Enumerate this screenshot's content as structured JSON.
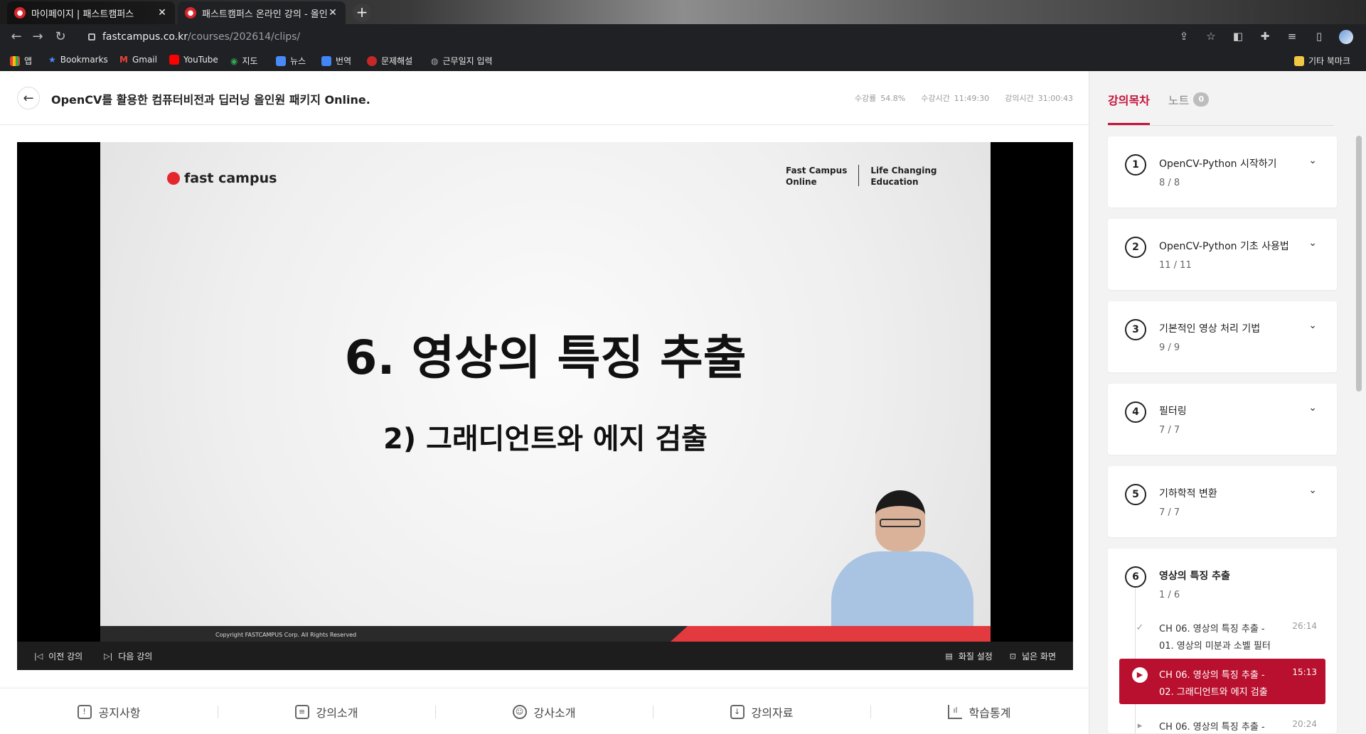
{
  "browser": {
    "tabs": [
      {
        "title": "마이페이지 | 패스트캠퍼스",
        "close": "✕"
      },
      {
        "title": "패스트캠퍼스 온라인 강의 - 올인",
        "close": "✕"
      }
    ],
    "new_tab": "+",
    "url_host": "fastcampus.co.kr",
    "url_path": "/courses/202614/clips/",
    "bookmarks": [
      "앱",
      "Bookmarks",
      "Gmail",
      "YouTube",
      "지도",
      "뉴스",
      "번역",
      "문제해설",
      "근무일지 입력"
    ],
    "other_bookmarks": "기타 북마크"
  },
  "header": {
    "course_title": "OpenCV를 활용한 컴퓨터비전과 딥러닝 올인원 패키지 Online.",
    "stats": [
      {
        "label": "수강률",
        "value": "54.8%"
      },
      {
        "label": "수강시간",
        "value": "11:49:30"
      },
      {
        "label": "강의시간",
        "value": "31:00:43"
      }
    ]
  },
  "slide": {
    "logo": "fast campus",
    "brand_left_1": "Fast Campus",
    "brand_left_2": "Online",
    "brand_right_1": "Life Changing",
    "brand_right_2": "Education",
    "title": "6. 영상의 특징 추출",
    "subtitle": "2) 그래디언트와 에지 검출",
    "copyright": "Copyright FASTCAMPUS Corp. All Rights Reserved"
  },
  "player_controls": {
    "prev": "이전 강의",
    "next": "다음 강의",
    "quality": "화질 설정",
    "wide": "넓은 화면"
  },
  "bottom_tabs": [
    "공지사항",
    "강의소개",
    "강사소개",
    "강의자료",
    "학습통계"
  ],
  "sidebar": {
    "tab_toc": "강의목차",
    "tab_note": "노트",
    "note_count": "0",
    "chapters": [
      {
        "num": "1",
        "title": "OpenCV-Python 시작하기",
        "count": "8 / 8"
      },
      {
        "num": "2",
        "title": "OpenCV-Python 기초 사용법",
        "count": "11 / 11"
      },
      {
        "num": "3",
        "title": "기본적인 영상 처리 기법",
        "count": "9 / 9"
      },
      {
        "num": "4",
        "title": "필터링",
        "count": "7 / 7"
      },
      {
        "num": "5",
        "title": "기하학적 변환",
        "count": "7 / 7"
      },
      {
        "num": "6",
        "title": "영상의 특징 추출",
        "count": "1 / 6"
      }
    ],
    "clips": [
      {
        "line1": "CH 06. 영상의 특징 추출 -",
        "line2": "01. 영상의 미분과 소벨 필터",
        "duration": "26:14"
      },
      {
        "line1": "CH 06. 영상의 특징 추출 -",
        "line2": "02. 그래디언트와 에지 검출",
        "duration": "15:13"
      },
      {
        "line1": "CH 06. 영상의 특징 추출 -",
        "line2": "",
        "duration": "20:24"
      }
    ]
  },
  "colors": {
    "accent": "#c5123a",
    "current_clip": "#b8102e"
  }
}
